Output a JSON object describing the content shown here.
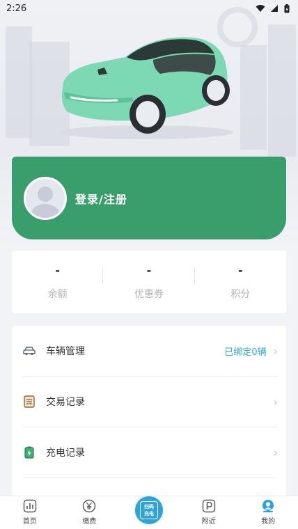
{
  "status_bar": {
    "time": "2:26"
  },
  "profile": {
    "login_label": "登录/注册"
  },
  "stats": [
    {
      "value": "-",
      "label": "余额"
    },
    {
      "value": "-",
      "label": "优惠券"
    },
    {
      "value": "-",
      "label": "积分"
    }
  ],
  "menu": [
    {
      "label": "车辆管理",
      "extra": "已绑定0辆",
      "icon": "car-icon"
    },
    {
      "label": "交易记录",
      "extra": "",
      "icon": "receipt-icon"
    },
    {
      "label": "充电记录",
      "extra": "",
      "icon": "battery-icon"
    }
  ],
  "tabs": [
    {
      "label": "首页",
      "icon": "home-chart-icon"
    },
    {
      "label": "缴费",
      "icon": "yuan-icon"
    },
    {
      "label": "附近",
      "icon": "parking-icon"
    },
    {
      "label": "我的",
      "icon": "user-icon",
      "active": true
    }
  ],
  "scan_button": {
    "line1": "扫码",
    "line2": "充电"
  },
  "colors": {
    "brand_green": "#3a9e6c",
    "accent_blue": "#2aa7c9",
    "car_mint": "#7dd9b3"
  }
}
